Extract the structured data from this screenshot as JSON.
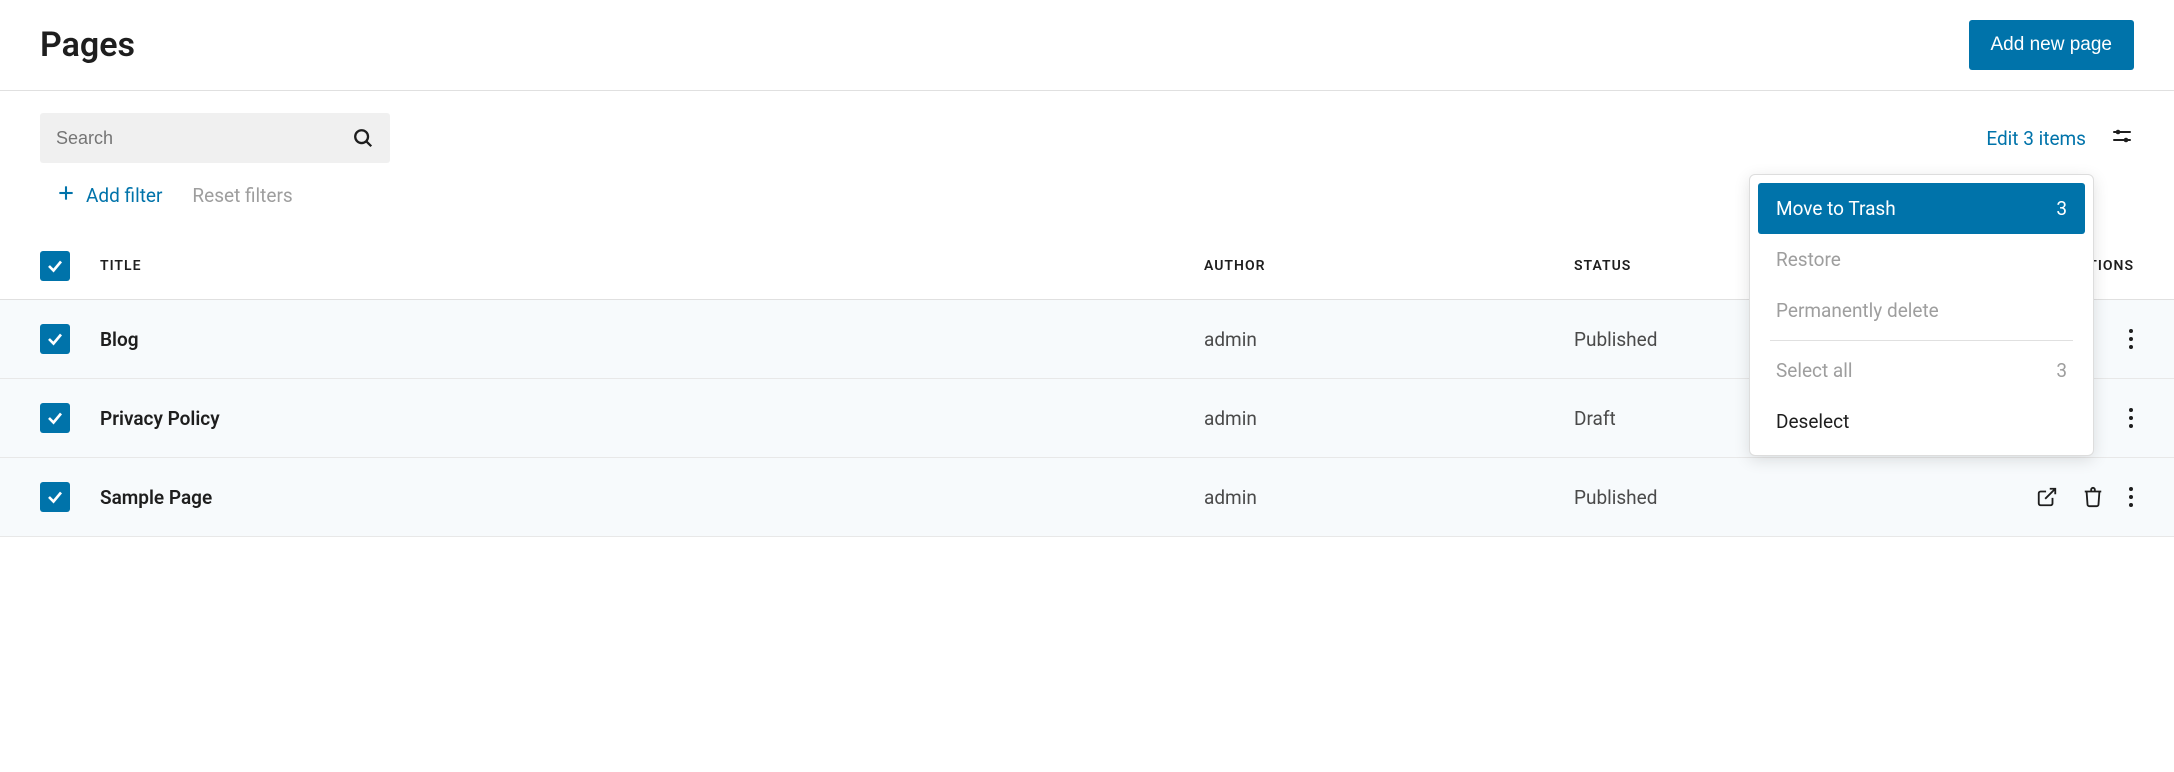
{
  "header": {
    "title": "Pages",
    "add_button": "Add new page"
  },
  "toolbar": {
    "search_placeholder": "Search",
    "edit_items": "Edit 3 items"
  },
  "filters": {
    "add_filter": "Add filter",
    "reset_filters": "Reset filters"
  },
  "columns": {
    "title": "TITLE",
    "author": "AUTHOR",
    "status": "STATUS",
    "actions": "ACTIONS"
  },
  "rows": [
    {
      "title": "Blog",
      "author": "admin",
      "status": "Published"
    },
    {
      "title": "Privacy Policy",
      "author": "admin",
      "status": "Draft"
    },
    {
      "title": "Sample Page",
      "author": "admin",
      "status": "Published"
    }
  ],
  "dropdown": {
    "move_to_trash": "Move to Trash",
    "move_to_trash_count": "3",
    "restore": "Restore",
    "permanently_delete": "Permanently delete",
    "select_all": "Select all",
    "select_all_count": "3",
    "deselect": "Deselect"
  }
}
